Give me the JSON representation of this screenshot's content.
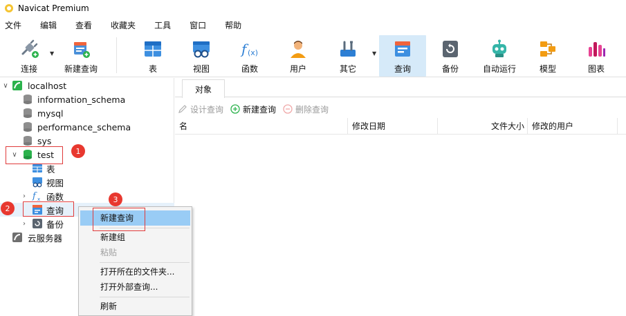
{
  "window": {
    "title": "Navicat Premium"
  },
  "menubar": [
    "文件",
    "编辑",
    "查看",
    "收藏夹",
    "工具",
    "窗口",
    "帮助"
  ],
  "toolbar": {
    "connect": "连接",
    "new_query": "新建查询",
    "table": "表",
    "view": "视图",
    "function": "函数",
    "user": "用户",
    "other": "其它",
    "query": "查询",
    "backup": "备份",
    "automation": "自动运行",
    "model": "模型",
    "chart": "图表"
  },
  "sidebar": {
    "connection": "localhost",
    "databases": [
      "information_schema",
      "mysql",
      "performance_schema",
      "sys"
    ],
    "open_db": "test",
    "children": {
      "table": "表",
      "view": "视图",
      "function": "函数",
      "query": "查询",
      "backup": "备份"
    },
    "cloud": "云服务器"
  },
  "main": {
    "tab": "对象",
    "actions": {
      "design": "设计查询",
      "new": "新建查询",
      "delete": "删除查询"
    },
    "columns": {
      "name": "名",
      "modified": "修改日期",
      "size": "文件大小",
      "user": "修改的用户"
    }
  },
  "context_menu": {
    "new_query": "新建查询",
    "new_group": "新建组",
    "paste": "粘贴",
    "open_folder": "打开所在的文件夹...",
    "open_external": "打开外部查询...",
    "refresh": "刷新"
  },
  "annotations": {
    "b1": "1",
    "b2": "2",
    "b3": "3"
  },
  "colors": {
    "selected_tool": "#d6eaf9",
    "menu_highlight": "#99ccf5",
    "annotation": "#e03a3a",
    "db_green": "#2bb24c"
  }
}
